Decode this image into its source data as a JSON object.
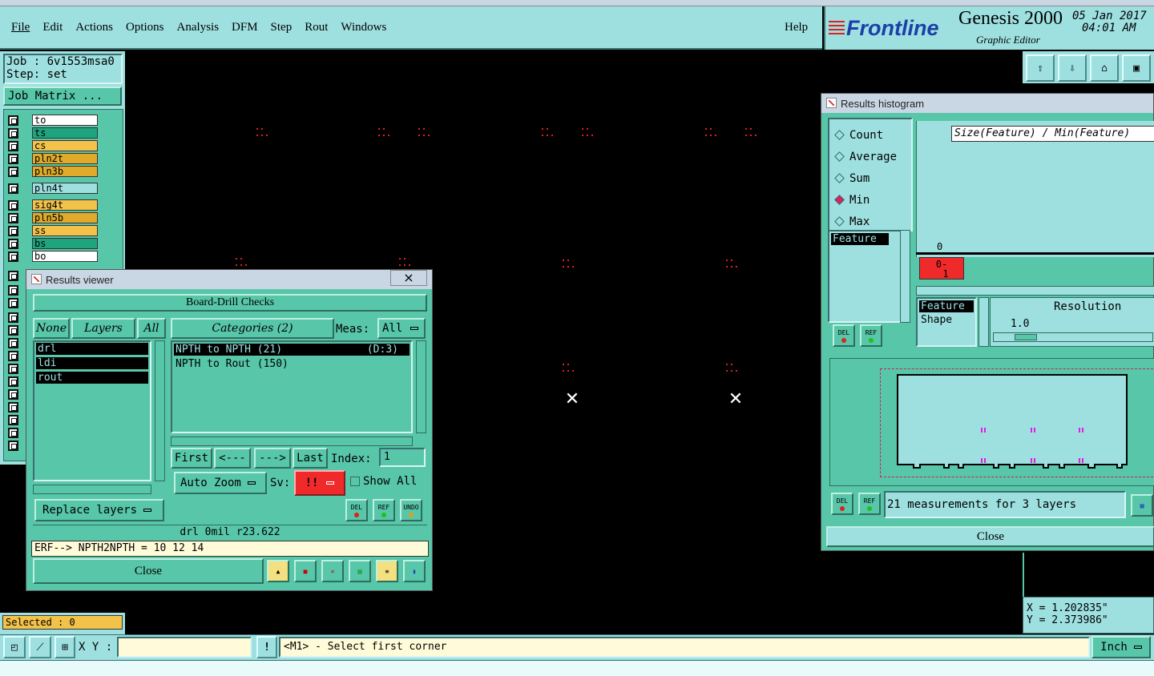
{
  "menu": {
    "items": [
      "File",
      "Edit",
      "Actions",
      "Options",
      "Analysis",
      "DFM",
      "Step",
      "Rout",
      "Windows"
    ],
    "help": "Help"
  },
  "brand": {
    "logo": "Frontline",
    "product": "Genesis 2000",
    "subtitle": "Graphic Editor",
    "date": "05 Jan 2017",
    "time": "04:01 AM"
  },
  "job": {
    "job_label": "Job : 6v1553msa0",
    "step_label": "Step: set",
    "matrix_button": "Job Matrix ..."
  },
  "layers": [
    {
      "name": "to",
      "color": "#ffffff"
    },
    {
      "name": "ts",
      "color": "#1fa57e"
    },
    {
      "name": "cs",
      "color": "#f3c24a"
    },
    {
      "name": "pln2t",
      "color": "#e0ab2a"
    },
    {
      "name": "pln3b",
      "color": "#e0ab2a"
    },
    {
      "name": "pln4t",
      "color": "#9ee0e0"
    },
    {
      "name": "sig4t",
      "color": "#f3c24a"
    },
    {
      "name": "pln5b",
      "color": "#e0ab2a"
    },
    {
      "name": "ss",
      "color": "#f3c24a"
    },
    {
      "name": "bs",
      "color": "#1fa57e"
    },
    {
      "name": "bo",
      "color": "#ffffff"
    }
  ],
  "selected": "Selected : 0",
  "results_viewer": {
    "title": "Results viewer",
    "close_x": "×",
    "header": "Board-Drill Checks",
    "none_btn": "None",
    "layers_btn": "Layers",
    "all_btn": "All",
    "layer_list": [
      "drl",
      "ldi",
      "rout"
    ],
    "categories_btn": "Categories (2)",
    "meas_label": "Meas:",
    "meas_value": "All",
    "categories": [
      {
        "text": "NPTH to NPTH  (21)",
        "extra": "(D:3)"
      },
      {
        "text": "NPTH to Rout  (150)",
        "extra": ""
      }
    ],
    "first": "First",
    "prev": "<---",
    "next": "--->",
    "last": "Last",
    "index_label": "Index:",
    "index_value": "1",
    "auto_zoom": "Auto Zoom",
    "sv_label": "Sv:",
    "sv_value": "!!",
    "show_all": "Show All",
    "replace_layers": "Replace layers",
    "del": "DEL",
    "ref": "REF",
    "undo": "UNDO",
    "status": "drl  0mil  r23.622",
    "erf": "ERF--> NPTH2NPTH = 10 12 14",
    "close": "Close"
  },
  "histogram": {
    "title": "Results histogram",
    "options": [
      {
        "label": "Count",
        "on": false
      },
      {
        "label": "Average",
        "on": false
      },
      {
        "label": "Sum",
        "on": false
      },
      {
        "label": "Min",
        "on": true
      },
      {
        "label": "Max",
        "on": false
      }
    ],
    "feature": "Feature",
    "formula": "Size(Feature) / Min(Feature)",
    "axis_zero": "0",
    "bar_label_1": "0-",
    "bar_label_2": "1",
    "list": [
      "Feature",
      "Shape"
    ],
    "resolution_label": "Resolution",
    "resolution_value": "1.0",
    "del": "DEL",
    "ref": "REF",
    "measurements": "21 measurements for 3 layers",
    "close": "Close"
  },
  "coords": {
    "x": "X = 1.202835\"",
    "y": "Y = 2.373986\""
  },
  "bottom": {
    "xy_label": "X Y :",
    "xy_value": "",
    "prompt": "<M1> - Select first corner",
    "unit": "Inch"
  }
}
